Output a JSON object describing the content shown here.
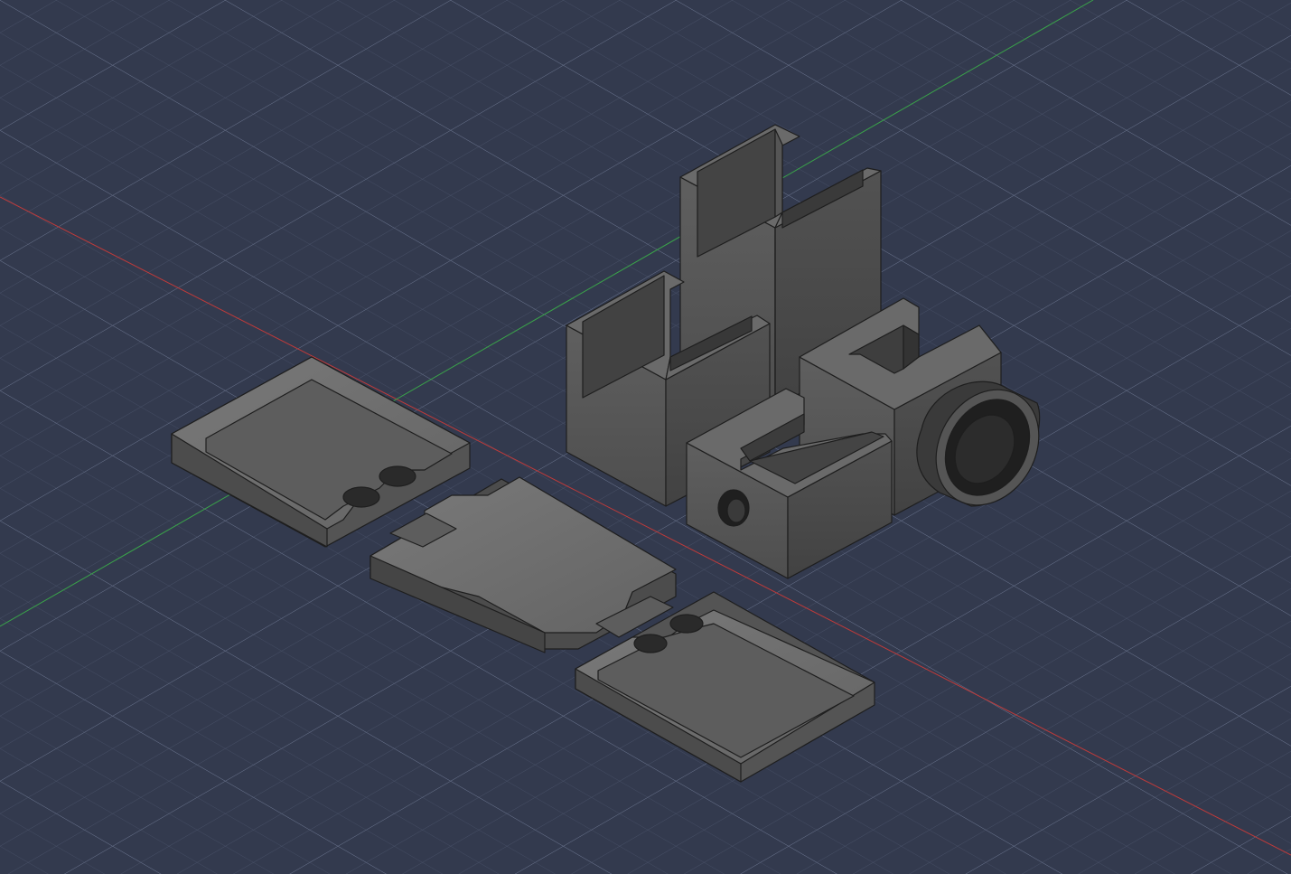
{
  "viewport": {
    "background": "#333a4e",
    "grid_color": "#56607a",
    "grid_major_color": "#6c7690",
    "x_axis_color": "#c03a3a",
    "y_axis_color": "#3aa34a"
  },
  "model": {
    "body_color_top": "#6f6f6f",
    "body_color_left": "#565656",
    "body_color_right": "#4a4a4a",
    "edge_color": "#1e1e1e",
    "parts": [
      "tall-u-channel",
      "short-u-channel-left",
      "cube-clip-block",
      "lens-holder-block",
      "lens-ring",
      "tray-left",
      "tray-center",
      "tray-right"
    ]
  }
}
